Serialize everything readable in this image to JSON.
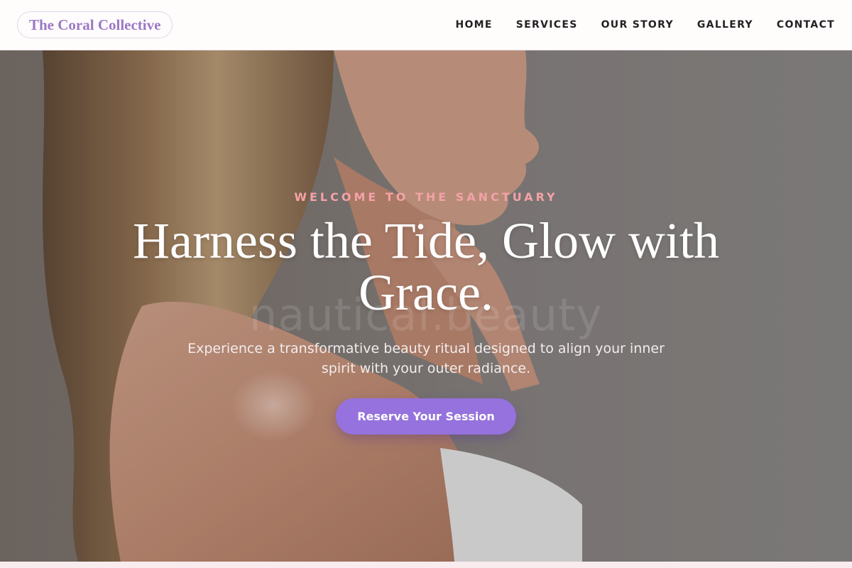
{
  "header": {
    "logo_text": "The Coral Collective",
    "nav": [
      {
        "label": "HOME"
      },
      {
        "label": "SERVICES"
      },
      {
        "label": "OUR STORY"
      },
      {
        "label": "GALLERY"
      },
      {
        "label": "CONTACT"
      }
    ]
  },
  "hero": {
    "eyebrow": "WELCOME TO THE SANCTUARY",
    "headline": "Harness the Tide, Glow with Grace.",
    "watermark": "nautical.beauty",
    "subtext": "Experience a transformative beauty ritual designed to align your inner spirit with your outer radiance.",
    "cta_label": "Reserve Your Session"
  },
  "colors": {
    "brand_purple": "#9572dd",
    "logo_purple": "#9b78c4",
    "eyebrow_pink": "#f4a2a8",
    "header_bg": "#fffcfc"
  }
}
